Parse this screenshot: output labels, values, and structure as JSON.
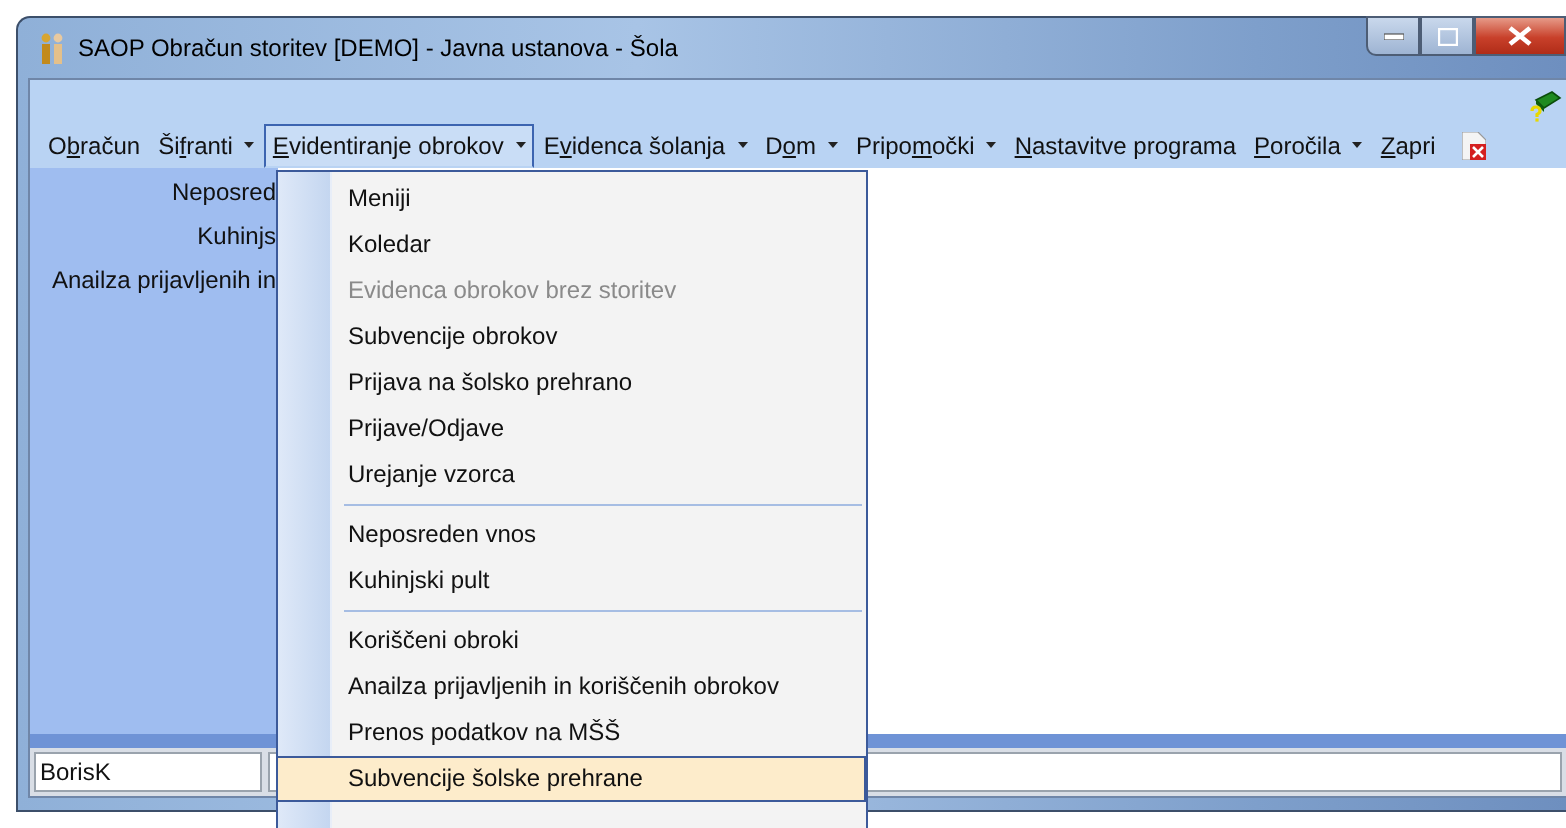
{
  "window": {
    "title": "SAOP Obračun storitev [DEMO] - Javna ustanova - Šola"
  },
  "menu_bar": [
    {
      "pre": "O",
      "key": "b",
      "post": "račun",
      "dropdown": false,
      "selected": false
    },
    {
      "pre": "Ši",
      "key": "f",
      "post": "ranti",
      "dropdown": true,
      "selected": false
    },
    {
      "key": "E",
      "post": "videntiranje obrokov",
      "dropdown": true,
      "selected": true
    },
    {
      "pre": "E",
      "key": "v",
      "post": "idenca šolanja",
      "dropdown": true,
      "selected": false
    },
    {
      "pre": "D",
      "key": "o",
      "post": "m",
      "dropdown": true,
      "selected": false
    },
    {
      "pre": "Pripo",
      "key": "m",
      "post": "očki",
      "dropdown": true,
      "selected": false
    },
    {
      "key": "N",
      "post": "astavitve programa",
      "dropdown": false,
      "selected": false
    },
    {
      "key": "P",
      "post": "oročila",
      "dropdown": true,
      "selected": false
    },
    {
      "key": "Z",
      "post": "apri",
      "dropdown": false,
      "selected": false
    }
  ],
  "side_labels": [
    "Neposred",
    "Kuhinjs",
    "Anailza prijavljenih in"
  ],
  "status_bar": {
    "user": "BorisK"
  },
  "open_menu": {
    "items": [
      {
        "kind": "item",
        "label": "Meniji",
        "disabled": false,
        "selected": false
      },
      {
        "kind": "item",
        "label": "Koledar",
        "disabled": false,
        "selected": false
      },
      {
        "kind": "item",
        "label": "Evidenca obrokov brez storitev",
        "disabled": true,
        "selected": false
      },
      {
        "kind": "item",
        "label": "Subvencije obrokov",
        "disabled": false,
        "selected": false
      },
      {
        "kind": "item",
        "label": "Prijava na šolsko prehrano",
        "disabled": false,
        "selected": false
      },
      {
        "kind": "item",
        "label": "Prijave/Odjave",
        "disabled": false,
        "selected": false
      },
      {
        "kind": "item",
        "label": "Urejanje vzorca",
        "disabled": false,
        "selected": false
      },
      {
        "kind": "separator"
      },
      {
        "kind": "item",
        "label": "Neposreden vnos",
        "disabled": false,
        "selected": false
      },
      {
        "kind": "item",
        "label": "Kuhinjski pult",
        "disabled": false,
        "selected": false
      },
      {
        "kind": "separator"
      },
      {
        "kind": "item",
        "label": "Koriščeni obroki",
        "disabled": false,
        "selected": false
      },
      {
        "kind": "item",
        "label": "Anailza prijavljenih in koriščenih obrokov",
        "disabled": false,
        "selected": false
      },
      {
        "kind": "item",
        "label": "Prenos podatkov na MŠŠ",
        "disabled": false,
        "selected": false
      },
      {
        "kind": "item",
        "label": "Subvencije šolske prehrane",
        "disabled": false,
        "selected": true
      }
    ]
  }
}
